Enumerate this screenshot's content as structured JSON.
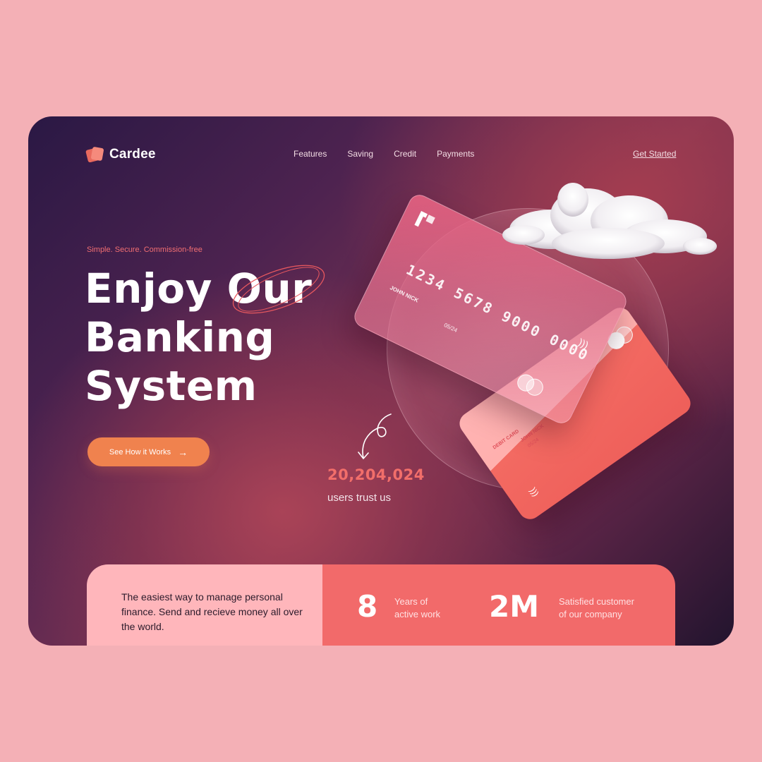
{
  "brand": {
    "name": "Cardee"
  },
  "nav": {
    "items": [
      "Features",
      "Saving",
      "Credit",
      "Payments"
    ],
    "cta": "Get Started"
  },
  "hero": {
    "tagline": "Simple. Secure. Commission-free",
    "headline": [
      "Enjoy Our",
      "Banking",
      "System"
    ],
    "button_label": "See How it Works",
    "users_count": "20,204,024",
    "users_label": "users trust us"
  },
  "card_front": {
    "number": "1234 5678 9000 0000",
    "holder": "JOHN NICK",
    "expiry": "05/24"
  },
  "card_back": {
    "type": "DEBIT CARD",
    "holder": "JOHN NICK",
    "expiry": "05/24"
  },
  "bottom": {
    "description": "The easiest way to manage personal finance. Send and recieve money all over the world.",
    "stats": [
      {
        "value": "8",
        "label_line1": "Years of",
        "label_line2": "active work"
      },
      {
        "value": "2M",
        "label_line1": "Satisfied customer",
        "label_line2": "of our company"
      }
    ]
  },
  "colors": {
    "page_bg": "#f4b0b6",
    "accent_orange": "#f0824e",
    "accent_coral": "#f26a6a",
    "panel_pink": "#ffb6bb"
  },
  "icons": [
    "cards-logo-icon",
    "arrow-right-icon",
    "curly-arrow-icon",
    "contactless-icon",
    "mastercard-icon",
    "cloud-icon"
  ]
}
